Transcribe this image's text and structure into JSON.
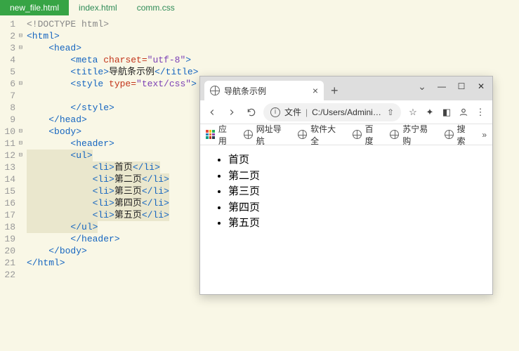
{
  "editor": {
    "tabs": [
      {
        "label": "new_file.html",
        "active": true
      },
      {
        "label": "index.html",
        "active": false
      },
      {
        "label": "comm.css",
        "active": false
      }
    ],
    "lines": [
      {
        "n": 1,
        "fold": "",
        "indent": 0,
        "tokens": [
          [
            "doctype",
            "<!DOCTYPE html>"
          ]
        ]
      },
      {
        "n": 2,
        "fold": "⊟",
        "indent": 0,
        "tokens": [
          [
            "tag",
            "<html>"
          ]
        ]
      },
      {
        "n": 3,
        "fold": "⊟",
        "indent": 1,
        "tokens": [
          [
            "tag",
            "<head>"
          ]
        ]
      },
      {
        "n": 4,
        "fold": "",
        "indent": 2,
        "tokens": [
          [
            "tag",
            "<meta "
          ],
          [
            "attr",
            "charset="
          ],
          [
            "str",
            "\"utf-8\""
          ],
          [
            "tag",
            ">"
          ]
        ]
      },
      {
        "n": 5,
        "fold": "",
        "indent": 2,
        "tokens": [
          [
            "tag",
            "<title>"
          ],
          [
            "text",
            "导航条示例"
          ],
          [
            "tag",
            "</title>"
          ]
        ]
      },
      {
        "n": 6,
        "fold": "⊟",
        "indent": 2,
        "tokens": [
          [
            "tag",
            "<style "
          ],
          [
            "attr",
            "type="
          ],
          [
            "str",
            "\"text/css\""
          ],
          [
            "tag",
            ">"
          ]
        ]
      },
      {
        "n": 7,
        "fold": "",
        "indent": 2,
        "tokens": []
      },
      {
        "n": 8,
        "fold": "",
        "indent": 2,
        "tokens": [
          [
            "tag",
            "</style>"
          ]
        ]
      },
      {
        "n": 9,
        "fold": "",
        "indent": 1,
        "tokens": [
          [
            "tag",
            "</head>"
          ]
        ]
      },
      {
        "n": 10,
        "fold": "⊟",
        "indent": 1,
        "tokens": [
          [
            "tag",
            "<body>"
          ]
        ]
      },
      {
        "n": 11,
        "fold": "⊟",
        "indent": 2,
        "tokens": [
          [
            "tag",
            "<header>"
          ]
        ]
      },
      {
        "n": 12,
        "fold": "⊟",
        "indent": 2,
        "hl": true,
        "tokens": [
          [
            "tag",
            "<ul>"
          ]
        ]
      },
      {
        "n": 13,
        "fold": "",
        "indent": 3,
        "hl": true,
        "tokens": [
          [
            "tag",
            "<li>"
          ],
          [
            "text",
            "首页"
          ],
          [
            "tag",
            "</li>"
          ]
        ]
      },
      {
        "n": 14,
        "fold": "",
        "indent": 3,
        "hl": true,
        "tokens": [
          [
            "tag",
            "<li>"
          ],
          [
            "text",
            "第二页"
          ],
          [
            "tag",
            "</li>"
          ]
        ]
      },
      {
        "n": 15,
        "fold": "",
        "indent": 3,
        "hl": true,
        "tokens": [
          [
            "tag",
            "<li>"
          ],
          [
            "text",
            "第三页"
          ],
          [
            "tag",
            "</li>"
          ]
        ]
      },
      {
        "n": 16,
        "fold": "",
        "indent": 3,
        "hl": true,
        "tokens": [
          [
            "tag",
            "<li>"
          ],
          [
            "text",
            "第四页"
          ],
          [
            "tag",
            "</li>"
          ]
        ]
      },
      {
        "n": 17,
        "fold": "",
        "indent": 3,
        "hl": true,
        "tokens": [
          [
            "tag",
            "<li>"
          ],
          [
            "text",
            "第五页"
          ],
          [
            "tag",
            "</li>"
          ]
        ]
      },
      {
        "n": 18,
        "fold": "",
        "indent": 2,
        "hl": true,
        "tokens": [
          [
            "tag",
            "</ul>"
          ]
        ]
      },
      {
        "n": 19,
        "fold": "",
        "indent": 2,
        "tokens": [
          [
            "tag",
            "</header>"
          ]
        ]
      },
      {
        "n": 20,
        "fold": "",
        "indent": 1,
        "tokens": [
          [
            "tag",
            "</body>"
          ]
        ]
      },
      {
        "n": 21,
        "fold": "",
        "indent": 0,
        "tokens": [
          [
            "tag",
            "</html>"
          ]
        ]
      },
      {
        "n": 22,
        "fold": "",
        "indent": 0,
        "tokens": []
      }
    ]
  },
  "browser": {
    "tab_title": "导航条示例",
    "address_prefix": "文件",
    "address_path": "C:/Users/Administr...",
    "bookmarks": {
      "apps": "应用",
      "items": [
        "网址导航",
        "软件大全",
        "百度",
        "苏宁易购",
        "搜索"
      ]
    },
    "page_items": [
      "首页",
      "第二页",
      "第三页",
      "第四页",
      "第五页"
    ]
  }
}
